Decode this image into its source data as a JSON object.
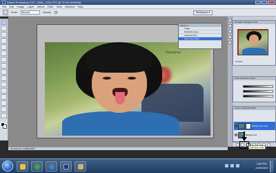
{
  "window": {
    "title": "Adobe Photoshop CS3 - [IMG_1234.JPG @ 33.3% (RGB/8)]",
    "controls": [
      "minimize",
      "maximize",
      "close"
    ]
  },
  "menubar": {
    "items": [
      "File",
      "Edit",
      "Image",
      "Layer",
      "Select",
      "Filter",
      "View",
      "Window",
      "Help"
    ],
    "workspace_label": "Workspace ▾"
  },
  "options": {
    "mode_label": "Mode:",
    "mode_value": "Normal",
    "opacity_label": "Opacity:",
    "workspace_button": "Workspace ▾"
  },
  "actions_popup": {
    "header": "Actions ×",
    "rows": [
      "Image",
      "Duplicate Layer",
      "Gaussian Blur",
      "Add Layer Mask"
    ],
    "selected_index": 3
  },
  "photo": {
    "signature": "Zuzanna"
  },
  "navigator": {
    "tab": "Navigator  Histogram  Info",
    "zoom": "33.33%"
  },
  "color_panel": {
    "tab": "Color  Swatches  Styles"
  },
  "layers_panel": {
    "tab": "Layers  Channels  Paths",
    "layers": [
      {
        "name": "Background copy",
        "selected": true
      },
      {
        "name": "Background",
        "selected": false
      }
    ]
  },
  "annotation": {
    "tooltip": "Add layer mask"
  },
  "statusbar": {
    "text": "33.33%  Doc: 2.25M/4.50M"
  },
  "taskbar": {
    "buttons": [
      {
        "name": "explorer",
        "color": "#e8c24a"
      },
      {
        "name": "media-player",
        "color": "#3aa34a"
      },
      {
        "name": "browser",
        "color": "#3f7ec9"
      },
      {
        "name": "photoshop",
        "color": "#1b3c7a"
      },
      {
        "name": "paint",
        "color": "#c9b27a"
      }
    ],
    "clock_time": "4:36 PM",
    "clock_date": "2/25/2009"
  },
  "colors": {
    "accent": "#2f6fd6",
    "highlight": "#e02020"
  }
}
